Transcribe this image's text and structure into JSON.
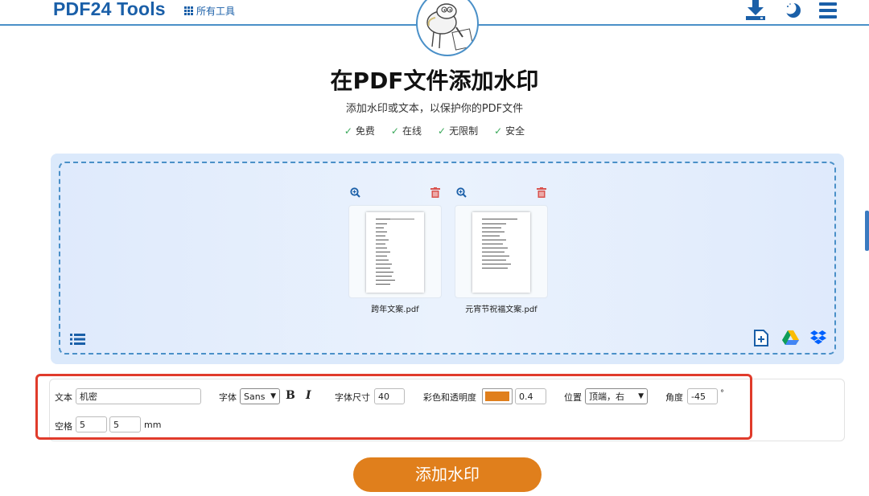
{
  "header": {
    "logo": "PDF24 Tools",
    "all_tools": "所有工具"
  },
  "hero": {
    "title": "在PDF文件添加水印",
    "subtitle": "添加水印或文本，以保护你的PDF文件",
    "features": [
      "免费",
      "在线",
      "无限制",
      "安全"
    ],
    "check": "✓"
  },
  "files": [
    {
      "name": "跨年文案.pdf"
    },
    {
      "name": "元宵节祝福文案.pdf"
    }
  ],
  "settings": {
    "text_label": "文本",
    "text_value": "机密",
    "font_label": "字体",
    "font_value": "Sans",
    "bold": "B",
    "italic": "I",
    "size_label": "字体尺寸",
    "size_value": "40",
    "color_label": "彩色和透明度",
    "color_value": "#e07f1c",
    "opacity_value": "0.4",
    "position_label": "位置",
    "position_value": "顶端，右",
    "angle_label": "角度",
    "angle_value": "-45",
    "angle_unit": "°",
    "spacing_label": "空格",
    "spacing_x": "5",
    "spacing_y": "5",
    "spacing_unit": "mm"
  },
  "action": {
    "submit": "添加水印"
  },
  "colors": {
    "brand": "#1a5fa8",
    "accent": "#e07f1c",
    "highlight": "#e03b2b"
  }
}
